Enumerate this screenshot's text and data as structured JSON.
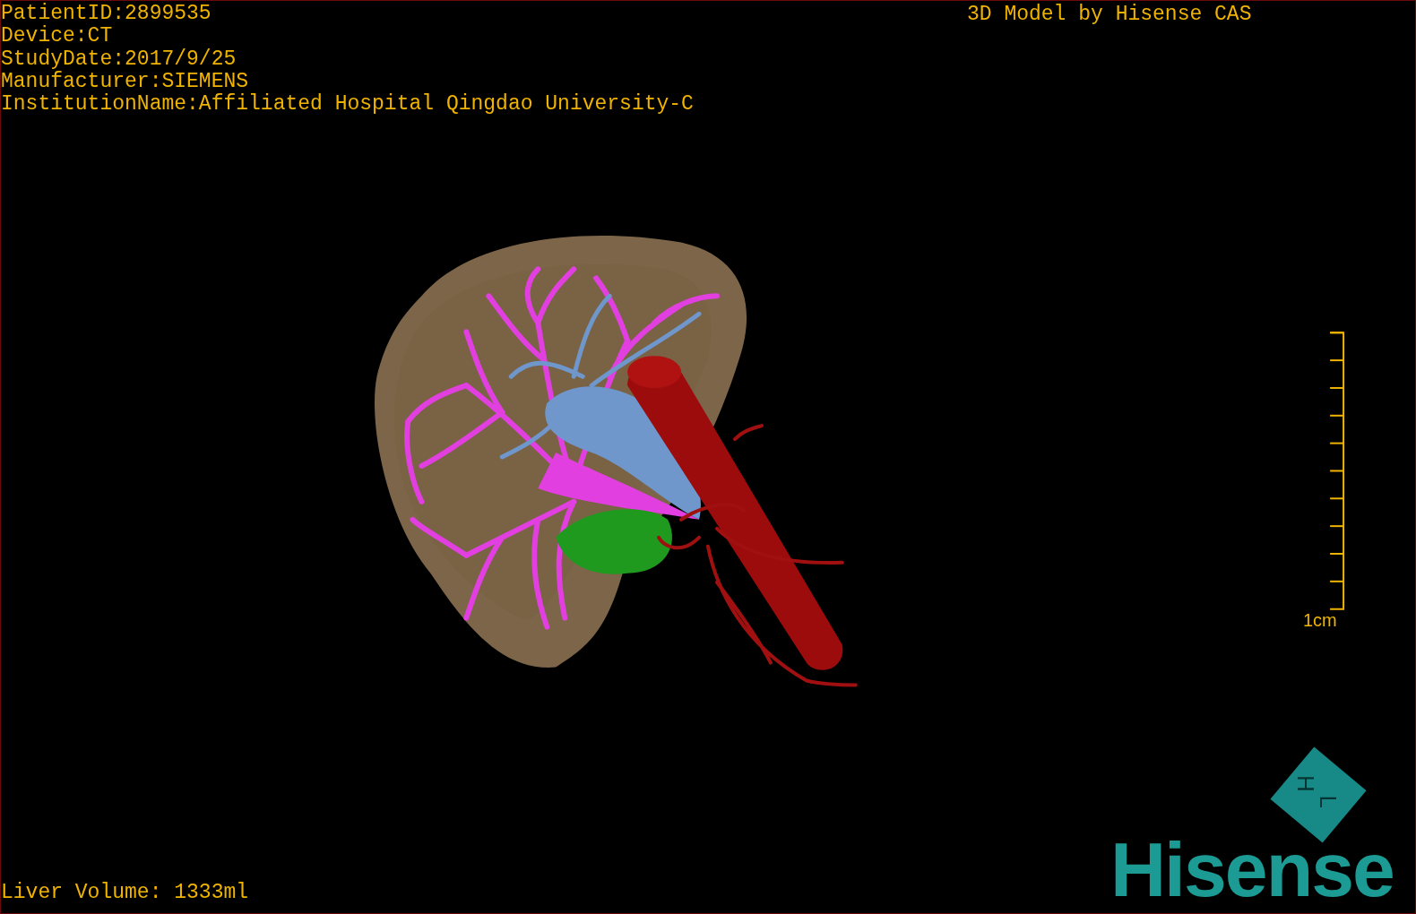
{
  "patient_info": [
    "PatientID:2899535",
    "Device:CT",
    "StudyDate:2017/9/25",
    "Manufacturer:SIEMENS",
    "InstitutionName:Affiliated Hospital Qingdao University-C"
  ],
  "model_credit": "3D Model by Hisense CAS",
  "scale_bar": {
    "label": "1cm"
  },
  "orientation_cube": {
    "faces": [
      "H",
      "L"
    ]
  },
  "liver_volume": "Liver Volume: 1333ml",
  "logo": {
    "text": "Hisense"
  }
}
